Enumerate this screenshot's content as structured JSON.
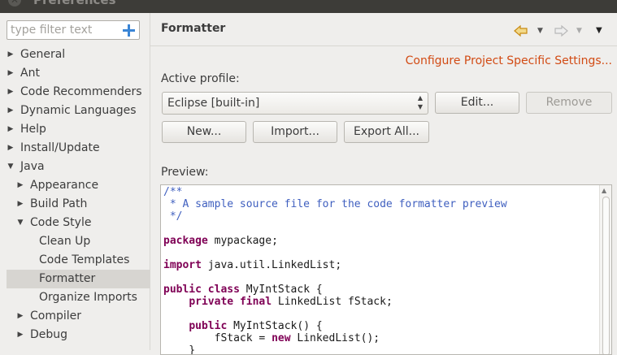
{
  "window": {
    "title": "Preferences"
  },
  "filter": {
    "placeholder": "type filter text"
  },
  "tree": [
    {
      "label": "General",
      "twisty": "▶",
      "indent": 0,
      "selected": false
    },
    {
      "label": "Ant",
      "twisty": "▶",
      "indent": 0,
      "selected": false
    },
    {
      "label": "Code Recommenders",
      "twisty": "▶",
      "indent": 0,
      "selected": false
    },
    {
      "label": "Dynamic Languages",
      "twisty": "▶",
      "indent": 0,
      "selected": false
    },
    {
      "label": "Help",
      "twisty": "▶",
      "indent": 0,
      "selected": false
    },
    {
      "label": "Install/Update",
      "twisty": "▶",
      "indent": 0,
      "selected": false
    },
    {
      "label": "Java",
      "twisty": "▼",
      "indent": 0,
      "selected": false
    },
    {
      "label": "Appearance",
      "twisty": "▶",
      "indent": 1,
      "selected": false
    },
    {
      "label": "Build Path",
      "twisty": "▶",
      "indent": 1,
      "selected": false
    },
    {
      "label": "Code Style",
      "twisty": "▼",
      "indent": 1,
      "selected": false
    },
    {
      "label": "Clean Up",
      "twisty": "",
      "indent": 2,
      "selected": false
    },
    {
      "label": "Code Templates",
      "twisty": "",
      "indent": 2,
      "selected": false
    },
    {
      "label": "Formatter",
      "twisty": "",
      "indent": 2,
      "selected": true
    },
    {
      "label": "Organize Imports",
      "twisty": "",
      "indent": 2,
      "selected": false
    },
    {
      "label": "Compiler",
      "twisty": "▶",
      "indent": 1,
      "selected": false
    },
    {
      "label": "Debug",
      "twisty": "▶",
      "indent": 1,
      "selected": false
    }
  ],
  "page": {
    "title": "Formatter",
    "configure_link": "Configure Project Specific Settings...",
    "active_profile_label": "Active profile:",
    "profile_selected": "Eclipse [built-in]",
    "buttons": {
      "edit": "Edit...",
      "remove": "Remove",
      "new": "New...",
      "import": "Import...",
      "export_all": "Export All..."
    },
    "preview_label": "Preview:"
  },
  "preview_code": [
    [
      [
        "cm",
        "/**"
      ]
    ],
    [
      [
        "cm",
        " * A sample source file for the code formatter preview"
      ]
    ],
    [
      [
        "cm",
        " */"
      ]
    ],
    [],
    [
      [
        "kw",
        "package"
      ],
      [
        "tx",
        " mypackage;"
      ]
    ],
    [],
    [
      [
        "kw",
        "import"
      ],
      [
        "tx",
        " java.util.LinkedList;"
      ]
    ],
    [],
    [
      [
        "kw",
        "public"
      ],
      [
        "tx",
        " "
      ],
      [
        "kw",
        "class"
      ],
      [
        "tx",
        " MyIntStack {"
      ]
    ],
    [
      [
        "tx",
        "    "
      ],
      [
        "kw",
        "private"
      ],
      [
        "tx",
        " "
      ],
      [
        "kw",
        "final"
      ],
      [
        "tx",
        " LinkedList fStack;"
      ]
    ],
    [],
    [
      [
        "tx",
        "    "
      ],
      [
        "kw",
        "public"
      ],
      [
        "tx",
        " MyIntStack() {"
      ]
    ],
    [
      [
        "tx",
        "        fStack = "
      ],
      [
        "kw",
        "new"
      ],
      [
        "tx",
        " LinkedList();"
      ]
    ],
    [
      [
        "tx",
        "    }"
      ]
    ]
  ],
  "colors": {
    "link": "#d24b14",
    "keyword": "#7f0055",
    "comment": "#3f5fbf",
    "nav_back": "#e7a521",
    "selection": "#d7d5d1"
  },
  "icons": {
    "close": "close-icon",
    "filter_clear": "filter-clear-icon",
    "back": "back-arrow-icon",
    "forward": "forward-arrow-icon",
    "menu": "view-menu-icon"
  }
}
